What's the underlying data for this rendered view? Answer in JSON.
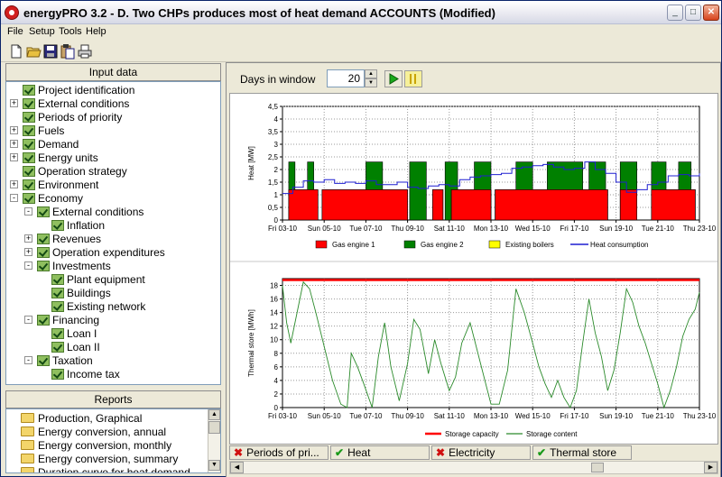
{
  "window": {
    "title": "energyPRO 3.2  -  D. Two CHPs produces most of heat demand ACCOUNTS (Modified)",
    "minimize_glyph": "_",
    "maximize_glyph": "□",
    "close_glyph": "✕"
  },
  "menu": [
    "File",
    "Setup",
    "Tools",
    "Help"
  ],
  "toolbar_icons": [
    "new-file-icon",
    "open-folder-icon",
    "save-icon",
    "paste-icon",
    "print-icon"
  ],
  "input_data": {
    "header": "Input data",
    "items": [
      {
        "label": "Project identification",
        "level": 0,
        "expander": ""
      },
      {
        "label": "External conditions",
        "level": 0,
        "expander": "+"
      },
      {
        "label": "Periods of priority",
        "level": 0,
        "expander": ""
      },
      {
        "label": "Fuels",
        "level": 0,
        "expander": "+"
      },
      {
        "label": "Demand",
        "level": 0,
        "expander": "+"
      },
      {
        "label": "Energy units",
        "level": 0,
        "expander": "+"
      },
      {
        "label": "Operation strategy",
        "level": 0,
        "expander": ""
      },
      {
        "label": "Environment",
        "level": 0,
        "expander": "+"
      },
      {
        "label": "Economy",
        "level": 0,
        "expander": "-"
      },
      {
        "label": "External conditions",
        "level": 1,
        "expander": "-"
      },
      {
        "label": "Inflation",
        "level": 2,
        "expander": ""
      },
      {
        "label": "Revenues",
        "level": 1,
        "expander": "+"
      },
      {
        "label": "Operation expenditures",
        "level": 1,
        "expander": "+"
      },
      {
        "label": "Investments",
        "level": 1,
        "expander": "-"
      },
      {
        "label": "Plant equipment",
        "level": 2,
        "expander": ""
      },
      {
        "label": "Buildings",
        "level": 2,
        "expander": ""
      },
      {
        "label": "Existing network",
        "level": 2,
        "expander": ""
      },
      {
        "label": "Financing",
        "level": 1,
        "expander": "-"
      },
      {
        "label": "Loan I",
        "level": 2,
        "expander": ""
      },
      {
        "label": "Loan II",
        "level": 2,
        "expander": ""
      },
      {
        "label": "Taxation",
        "level": 1,
        "expander": "-"
      },
      {
        "label": "Income tax",
        "level": 2,
        "expander": ""
      }
    ]
  },
  "reports": {
    "header": "Reports",
    "items": [
      "Production, Graphical",
      "Energy conversion, annual",
      "Energy conversion, monthly",
      "Energy conversion, summary",
      "Duration curve for heat demand"
    ]
  },
  "controls": {
    "days_label": "Days in window",
    "days_value": "20"
  },
  "tabs": [
    {
      "label": "Periods of pri...",
      "status": "x"
    },
    {
      "label": "Heat",
      "status": "ok"
    },
    {
      "label": "Electricity",
      "status": "x"
    },
    {
      "label": "Thermal store",
      "status": "ok"
    }
  ],
  "colors": {
    "gas_engine_1": "#ff0000",
    "gas_engine_2": "#008000",
    "existing_boilers": "#ffff00",
    "heat_consumption": "#1f1fd0",
    "storage_capacity": "#ff0000",
    "storage_content": "#2a8a2a"
  },
  "chart_data": [
    {
      "type": "area",
      "title": "",
      "ylabel": "Heat [MW]",
      "xlabel": "",
      "ylim": [
        0,
        4.5
      ],
      "yticks": [
        "0",
        "0,5",
        "1",
        "1,5",
        "2",
        "2,5",
        "3",
        "3,5",
        "4",
        "4,5"
      ],
      "xticks": [
        "Fri 03-10",
        "Sun 05-10",
        "Tue 07-10",
        "Thu 09-10",
        "Sat 11-10",
        "Mon 13-10",
        "Wed 15-10",
        "Fri 17-10",
        "Sun 19-10",
        "Tue 21-10",
        "Thu 23-10"
      ],
      "grid": true,
      "legend_position": "bottom",
      "days": 20,
      "series": [
        {
          "name": "Gas engine 1",
          "kind": "step-area",
          "segments": [
            [
              0.3,
              1.7,
              1.2
            ],
            [
              1.9,
              6.0,
              1.2
            ],
            [
              7.2,
              7.7,
              1.2
            ],
            [
              8.1,
              10.0,
              1.2
            ],
            [
              10.2,
              15.6,
              1.2
            ],
            [
              16.2,
              17.0,
              1.2
            ],
            [
              17.7,
              19.8,
              1.2
            ]
          ]
        },
        {
          "name": "Gas engine 2",
          "kind": "step-area",
          "segments": [
            [
              0.3,
              0.6,
              2.3
            ],
            [
              1.2,
              1.5,
              2.3
            ],
            [
              4.0,
              4.8,
              2.3
            ],
            [
              6.1,
              6.9,
              2.3
            ],
            [
              7.8,
              8.4,
              2.3
            ],
            [
              9.2,
              10.0,
              2.3
            ],
            [
              11.2,
              12.0,
              2.3
            ],
            [
              12.7,
              14.4,
              2.3
            ],
            [
              14.7,
              15.5,
              2.3
            ],
            [
              16.2,
              17.0,
              2.3
            ],
            [
              17.7,
              18.4,
              2.3
            ],
            [
              19.0,
              19.6,
              2.3
            ]
          ]
        },
        {
          "name": "Existing boilers",
          "kind": "step-area",
          "segments": []
        },
        {
          "name": "Heat consumption",
          "kind": "line",
          "x": [
            0,
            0.5,
            1,
            1.5,
            2,
            2.5,
            3,
            3.5,
            4,
            4.5,
            5,
            5.5,
            6,
            6.5,
            7,
            7.5,
            8,
            8.5,
            9,
            9.5,
            10,
            10.5,
            11,
            11.5,
            12,
            12.5,
            13,
            13.5,
            14,
            14.5,
            15,
            15.5,
            16,
            16.5,
            17,
            17.5,
            18,
            18.5,
            19,
            19.5,
            20
          ],
          "y": [
            1.05,
            1.3,
            1.55,
            1.5,
            1.6,
            1.45,
            1.5,
            1.45,
            1.55,
            1.4,
            1.4,
            1.5,
            1.3,
            1.25,
            1.35,
            1.4,
            1.35,
            1.6,
            1.7,
            1.75,
            1.8,
            1.85,
            2.05,
            2.1,
            2.15,
            2.2,
            2.1,
            2.0,
            2.05,
            2.3,
            2.0,
            1.85,
            1.5,
            1.1,
            1.2,
            1.4,
            1.5,
            1.75,
            1.8,
            1.75,
            1.85
          ]
        }
      ]
    },
    {
      "type": "line",
      "title": "",
      "ylabel": "Thermal store [MWh]",
      "xlabel": "",
      "ylim": [
        0,
        19
      ],
      "yticks": [
        "0",
        "2",
        "4",
        "6",
        "8",
        "10",
        "12",
        "14",
        "16",
        "18"
      ],
      "xticks": [
        "Fri 03-10",
        "Sun 05-10",
        "Tue 07-10",
        "Thu 09-10",
        "Sat 11-10",
        "Mon 13-10",
        "Wed 15-10",
        "Fri 17-10",
        "Sun 19-10",
        "Tue 21-10",
        "Thu 23-10"
      ],
      "grid": true,
      "legend_position": "bottom",
      "series": [
        {
          "name": "Storage capacity",
          "x": [
            0,
            20
          ],
          "y": [
            18.8,
            18.8
          ]
        },
        {
          "name": "Storage content",
          "x": [
            0,
            0.2,
            0.4,
            0.7,
            1.0,
            1.3,
            1.6,
            2.0,
            2.4,
            2.8,
            3.1,
            3.3,
            3.6,
            3.9,
            4.3,
            4.6,
            4.9,
            5.2,
            5.6,
            6.0,
            6.3,
            6.6,
            7.0,
            7.3,
            7.6,
            8.0,
            8.3,
            8.6,
            9.0,
            9.5,
            10.0,
            10.4,
            10.8,
            11.2,
            11.6,
            12.0,
            12.3,
            12.6,
            12.9,
            13.2,
            13.5,
            13.8,
            14.1,
            14.4,
            14.7,
            15.0,
            15.3,
            15.6,
            15.9,
            16.2,
            16.5,
            16.8,
            17.1,
            17.4,
            17.7,
            18.0,
            18.3,
            18.6,
            18.9,
            19.2,
            19.5,
            19.8,
            20.0
          ],
          "y": [
            18,
            12.5,
            9.5,
            14,
            18.5,
            17.5,
            14,
            9,
            4,
            0.5,
            0,
            8,
            6,
            3.5,
            0,
            7.5,
            12.5,
            6,
            1,
            6.5,
            13,
            11.5,
            5,
            10,
            6.5,
            2.5,
            4.5,
            9.5,
            12.5,
            6.5,
            0.5,
            0.5,
            5.5,
            17.5,
            14,
            9.5,
            6,
            3.5,
            1.5,
            4,
            1.5,
            0,
            2.5,
            9.5,
            16,
            11,
            7.5,
            2.5,
            5.5,
            11,
            17.5,
            15.5,
            12,
            9.5,
            6.5,
            3.5,
            0,
            2.5,
            6,
            10.5,
            13,
            14.5,
            17
          ]
        }
      ]
    }
  ]
}
